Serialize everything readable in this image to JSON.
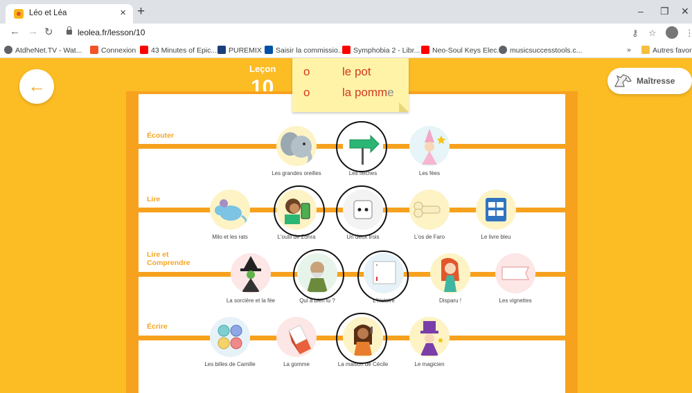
{
  "browser": {
    "tab_title": "Léo et Léa",
    "tab_close": "×",
    "new_tab": "+",
    "url": "leolea.fr/lesson/10",
    "win_min": "–",
    "win_max": "❐",
    "win_close": "✕",
    "more": "⋮",
    "bookmarks": [
      {
        "label": "AtdheNet.TV - Wat...",
        "color": "#5f6368"
      },
      {
        "label": "Connexion",
        "color": "#f35325"
      },
      {
        "label": "43 Minutes of Epic...",
        "color": "#ff0000"
      },
      {
        "label": "PUREMIX",
        "color": "#1a3f7a"
      },
      {
        "label": "Saisir la commissio...",
        "color": "#0050a4"
      },
      {
        "label": "Symphobia 2 - Libr...",
        "color": "#ff0000"
      },
      {
        "label": "Neo-Soul Keys Elec...",
        "color": "#ff0000"
      },
      {
        "label": "musicsuccesstools.c...",
        "color": "#5f6368"
      }
    ],
    "bookmarks_more": "»",
    "other_bookmarks": "Autres favoris"
  },
  "page": {
    "back_arrow": "←",
    "lesson_label": "Leçon",
    "lesson_number": "10",
    "teacher_button": "Maîtresse",
    "postit": {
      "rows": [
        {
          "letter": "o",
          "before": "le p",
          "hl": "o",
          "after": "t",
          "tail": ""
        },
        {
          "letter": "o",
          "before": "la p",
          "hl": "o",
          "after": "mm",
          "tail": "e"
        }
      ]
    },
    "sections": {
      "ecouter": "Écouter",
      "lire": "Lire",
      "lire_comprendre_1": "Lire et",
      "lire_comprendre_2": "Comprendre",
      "ecrire": "Écrire"
    },
    "activities": {
      "ecouter": [
        "Les grandes oreilles",
        "Les flèches",
        "Les fées"
      ],
      "lire": [
        "Milo et les rats",
        "L'outil de Zohra",
        "Un deux trois",
        "L'os de Faro",
        "Le livre bleu"
      ],
      "lire_comprendre": [
        "La sorcière et la fée",
        "Qui a bien lu ?",
        "L'histoire",
        "Disparu !",
        "Les vignettes"
      ],
      "ecrire": [
        "Les billes de Camille",
        "La gomme",
        "La maison de Cécile",
        "Le magicien"
      ]
    },
    "colors": {
      "background": "#fcbc24",
      "board": "#f7a21e",
      "accent": "#f5a623",
      "postit": "#fff3a8",
      "postit_text": "#d23a1e"
    }
  }
}
